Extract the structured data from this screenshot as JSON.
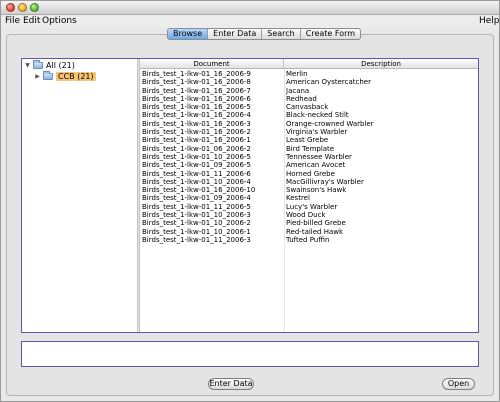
{
  "menubar": {
    "file": "File",
    "edit": "Edit",
    "options": "Options",
    "help": "Help"
  },
  "tabs": [
    {
      "label": "Browse",
      "active": true
    },
    {
      "label": "Enter Data",
      "active": false
    },
    {
      "label": "Search",
      "active": false
    },
    {
      "label": "Create Form",
      "active": false
    }
  ],
  "tree": {
    "root_label": "All  (21)",
    "child_label": "CCB  (21)"
  },
  "table": {
    "columns": [
      "Document",
      "Description"
    ],
    "rows": [
      {
        "document": "Birds_test_1-lkw-01_16_2006-9",
        "description": "Merlin"
      },
      {
        "document": "Birds_test_1-lkw-01_16_2006-8",
        "description": "American Oystercatcher"
      },
      {
        "document": "Birds_test_1-lkw-01_16_2006-7",
        "description": "Jacana"
      },
      {
        "document": "Birds_test_1-lkw-01_16_2006-6",
        "description": "Redhead"
      },
      {
        "document": "Birds_test_1-lkw-01_16_2006-5",
        "description": "Canvasback"
      },
      {
        "document": "Birds_test_1-lkw-01_16_2006-4",
        "description": "Black-necked Stilt"
      },
      {
        "document": "Birds_test_1-lkw-01_16_2006-3",
        "description": "Orange-crowned Warbler"
      },
      {
        "document": "Birds_test_1-lkw-01_16_2006-2",
        "description": "Virginia's Warbler"
      },
      {
        "document": "Birds_test_1-lkw-01_16_2006-1",
        "description": "Least Grebe"
      },
      {
        "document": "Birds_test_1-lkw-01_06_2006-2",
        "description": "Bird Template"
      },
      {
        "document": "Birds_test_1-lkw-01_10_2006-5",
        "description": "Tennessee Warbler"
      },
      {
        "document": "Birds_test_1-lkw-01_09_2006-5",
        "description": "American Avocet"
      },
      {
        "document": "Birds_test_1-lkw-01_11_2006-6",
        "description": "Horned Grebe"
      },
      {
        "document": "Birds_test_1-lkw-01_10_2006-4",
        "description": "MacGillivray's Warbler"
      },
      {
        "document": "Birds_test_1-lkw-01_16_2006-10",
        "description": "Swainson's Hawk"
      },
      {
        "document": "Birds_test_1-lkw-01_09_2006-4",
        "description": "Kestrel"
      },
      {
        "document": "Birds_test_1-lkw-01_11_2006-5",
        "description": "Lucy's Warbler"
      },
      {
        "document": "Birds_test_1-lkw-01_10_2006-3",
        "description": "Wood Duck"
      },
      {
        "document": "Birds_test_1-lkw-01_10_2006-2",
        "description": "Pied-billed Grebe"
      },
      {
        "document": "Birds_test_1-lkw-01_10_2006-1",
        "description": "Red-tailed Hawk"
      },
      {
        "document": "Birds_test_1-lkw-01_11_2006-3",
        "description": "Tufted Puffin"
      }
    ]
  },
  "buttons": {
    "enter_data": "Enter Data",
    "open": "Open"
  },
  "colors": {
    "active_tab": "#6ea7ea",
    "selected_node": "#f6c472",
    "frame_border": "#5d58a8"
  }
}
